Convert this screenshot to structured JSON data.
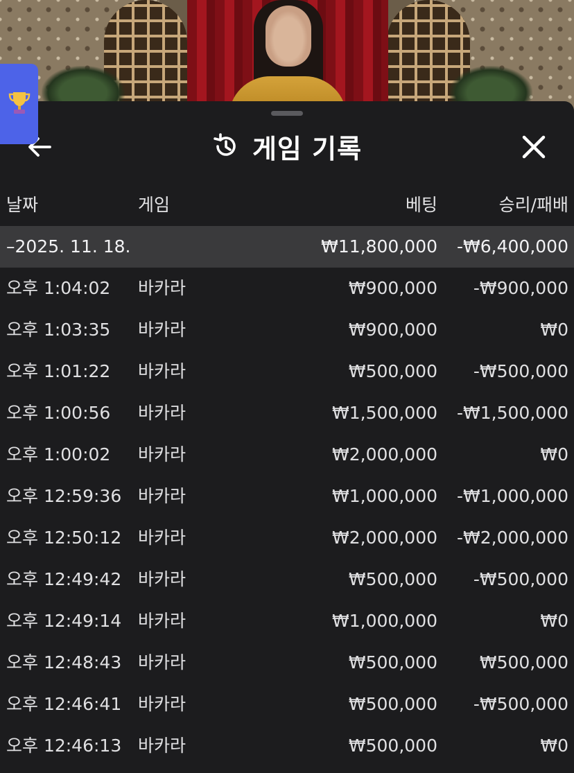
{
  "header": {
    "title": "게임 기록"
  },
  "columns": {
    "date": "날짜",
    "game": "게임",
    "bet": "베팅",
    "result": "승리/패배"
  },
  "group": {
    "date": "–2025. 11. 18.",
    "bet": "₩11,800,000",
    "result": "-₩6,400,000"
  },
  "rows": [
    {
      "time": "오후 1:04:02",
      "game": "바카라",
      "bet": "₩900,000",
      "result": "-₩900,000"
    },
    {
      "time": "오후 1:03:35",
      "game": "바카라",
      "bet": "₩900,000",
      "result": "₩0"
    },
    {
      "time": "오후 1:01:22",
      "game": "바카라",
      "bet": "₩500,000",
      "result": "-₩500,000"
    },
    {
      "time": "오후 1:00:56",
      "game": "바카라",
      "bet": "₩1,500,000",
      "result": "-₩1,500,000"
    },
    {
      "time": "오후 1:00:02",
      "game": "바카라",
      "bet": "₩2,000,000",
      "result": "₩0"
    },
    {
      "time": "오후 12:59:36",
      "game": "바카라",
      "bet": "₩1,000,000",
      "result": "-₩1,000,000"
    },
    {
      "time": "오후 12:50:12",
      "game": "바카라",
      "bet": "₩2,000,000",
      "result": "-₩2,000,000"
    },
    {
      "time": "오후 12:49:42",
      "game": "바카라",
      "bet": "₩500,000",
      "result": "-₩500,000"
    },
    {
      "time": "오후 12:49:14",
      "game": "바카라",
      "bet": "₩1,000,000",
      "result": "₩0"
    },
    {
      "time": "오후 12:48:43",
      "game": "바카라",
      "bet": "₩500,000",
      "result": "₩500,000"
    },
    {
      "time": "오후 12:46:41",
      "game": "바카라",
      "bet": "₩500,000",
      "result": "-₩500,000"
    },
    {
      "time": "오후 12:46:13",
      "game": "바카라",
      "bet": "₩500,000",
      "result": "₩0"
    }
  ],
  "icons": {
    "back": "arrow-left-icon",
    "history": "history-icon",
    "close": "close-icon",
    "trophy": "trophy-icon"
  },
  "colors": {
    "sheet_background": "#1c1c1e",
    "group_row_background": "#3a3a3c",
    "trophy_button": "#4d63e8"
  }
}
